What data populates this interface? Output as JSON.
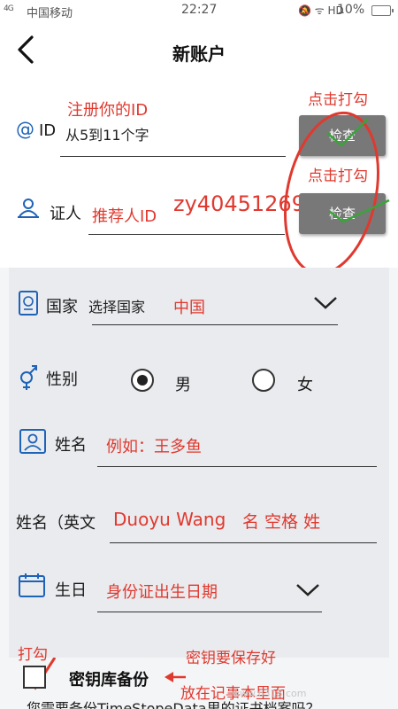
{
  "status_bar": {
    "signal": "4G",
    "carrier": "中国移动",
    "time": "22:27",
    "status_icons": "🔕 ᯤ HD",
    "battery": "10%"
  },
  "header": {
    "title": "新账户"
  },
  "form": {
    "id_label": "ID",
    "id_placeholder": "从5到11个字",
    "check_button": "检查",
    "referrer_label": "证人",
    "referrer_value": "zy40451269",
    "country_label": "国家",
    "country_placeholder": "选择国家",
    "gender_label": "性别",
    "gender_male": "男",
    "gender_female": "女",
    "name_label": "姓名",
    "english_name_label": "姓名（英文",
    "birthday_label": "生日",
    "backup_label": "密钥库备份",
    "backup_question": "您需要备份TimeStopeData里的证书档案吗？"
  },
  "annotations": {
    "register_id": "注册你的ID",
    "tap_check_1": "点击打勾",
    "tap_check_2": "点击打勾",
    "referrer_id": "推荐人ID",
    "country_example": "中国",
    "name_example": "例如：王多鱼",
    "english_name_example": "Duoyu Wang",
    "english_name_format": "名 空格 姓",
    "birthday_hint": "身份证出生日期",
    "tick_hint": "打勾",
    "keep_key": "密钥要保存好",
    "save_note": "放在记事本里面"
  },
  "watermark": "www.6318.com",
  "colors": {
    "annotation_red": "#e0392f",
    "button_gray": "#787878",
    "panel_bg": "#e9ebee",
    "icon_blue": "#1d63b8"
  }
}
